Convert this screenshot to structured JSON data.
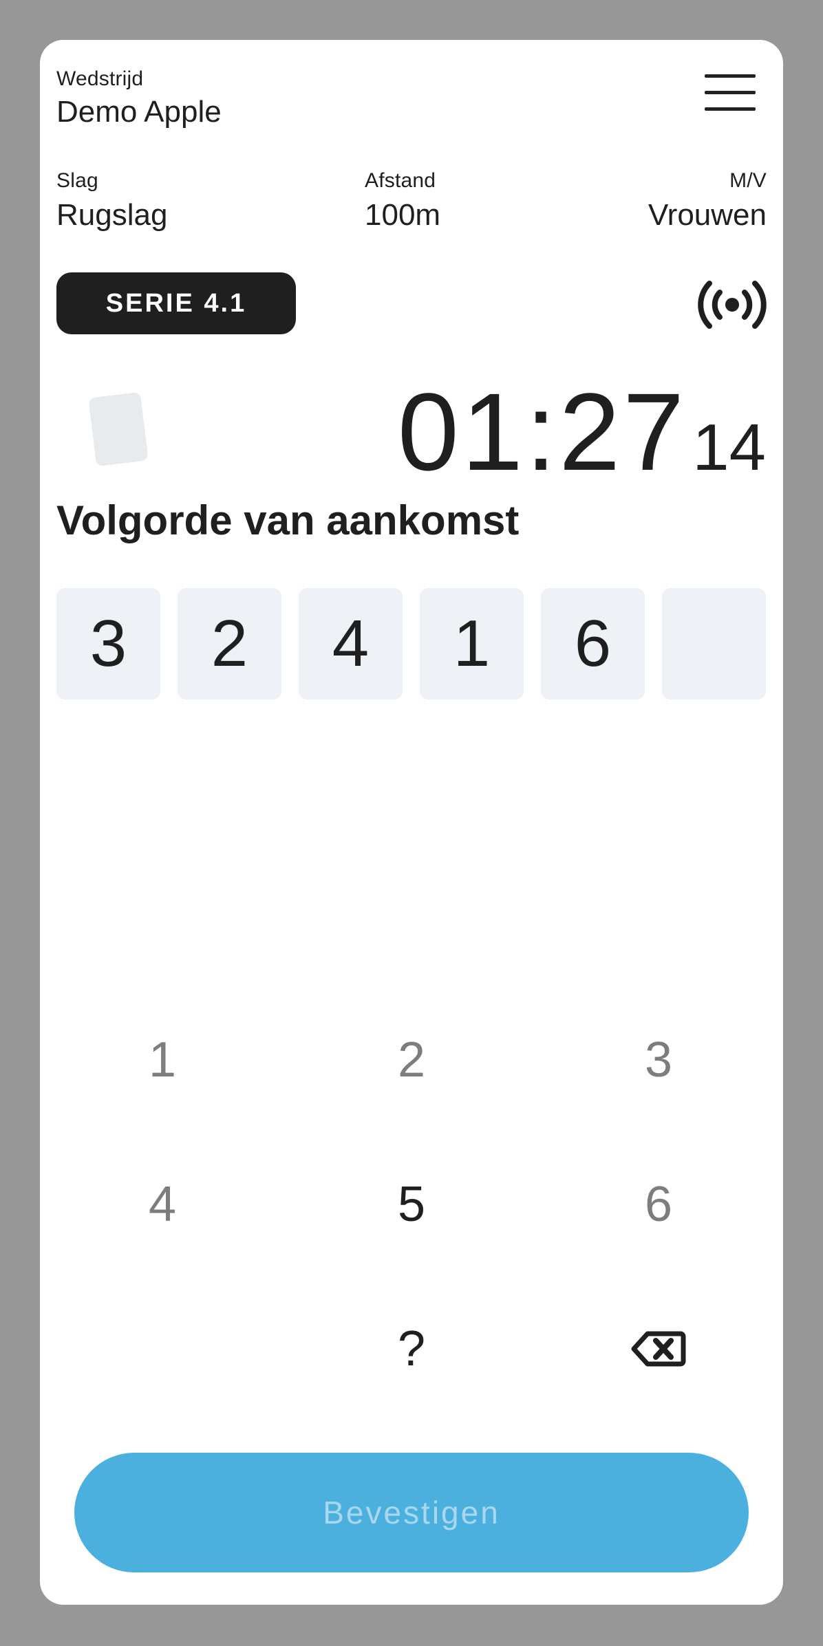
{
  "header": {
    "competition_label": "Wedstrijd",
    "competition_name": "Demo Apple"
  },
  "race_info": {
    "stroke_label": "Slag",
    "stroke_value": "Rugslag",
    "distance_label": "Afstand",
    "distance_value": "100m",
    "gender_label": "M/V",
    "gender_value": "Vrouwen"
  },
  "serie": {
    "label": "SERIE 4.1"
  },
  "timer": {
    "main": "01:27",
    "hundredths": "14"
  },
  "order": {
    "title": "Volgorde van aankomst",
    "slots": [
      "3",
      "2",
      "4",
      "1",
      "6",
      ""
    ]
  },
  "keypad": {
    "keys": [
      "1",
      "2",
      "3",
      "4",
      "5",
      "6",
      "?"
    ],
    "active_key": "5"
  },
  "confirm": {
    "label": "Bevestigen"
  },
  "colors": {
    "frame": "#979797",
    "confirm_bg": "#4cb0de",
    "confirm_text": "#a9d8ee",
    "slot_bg": "#eef2f7",
    "badge_bg": "#1f1f1f"
  },
  "icons": {
    "menu": "hamburger-menu-icon",
    "broadcast": "broadcast-icon",
    "card": "card-icon",
    "backspace": "backspace-icon"
  }
}
